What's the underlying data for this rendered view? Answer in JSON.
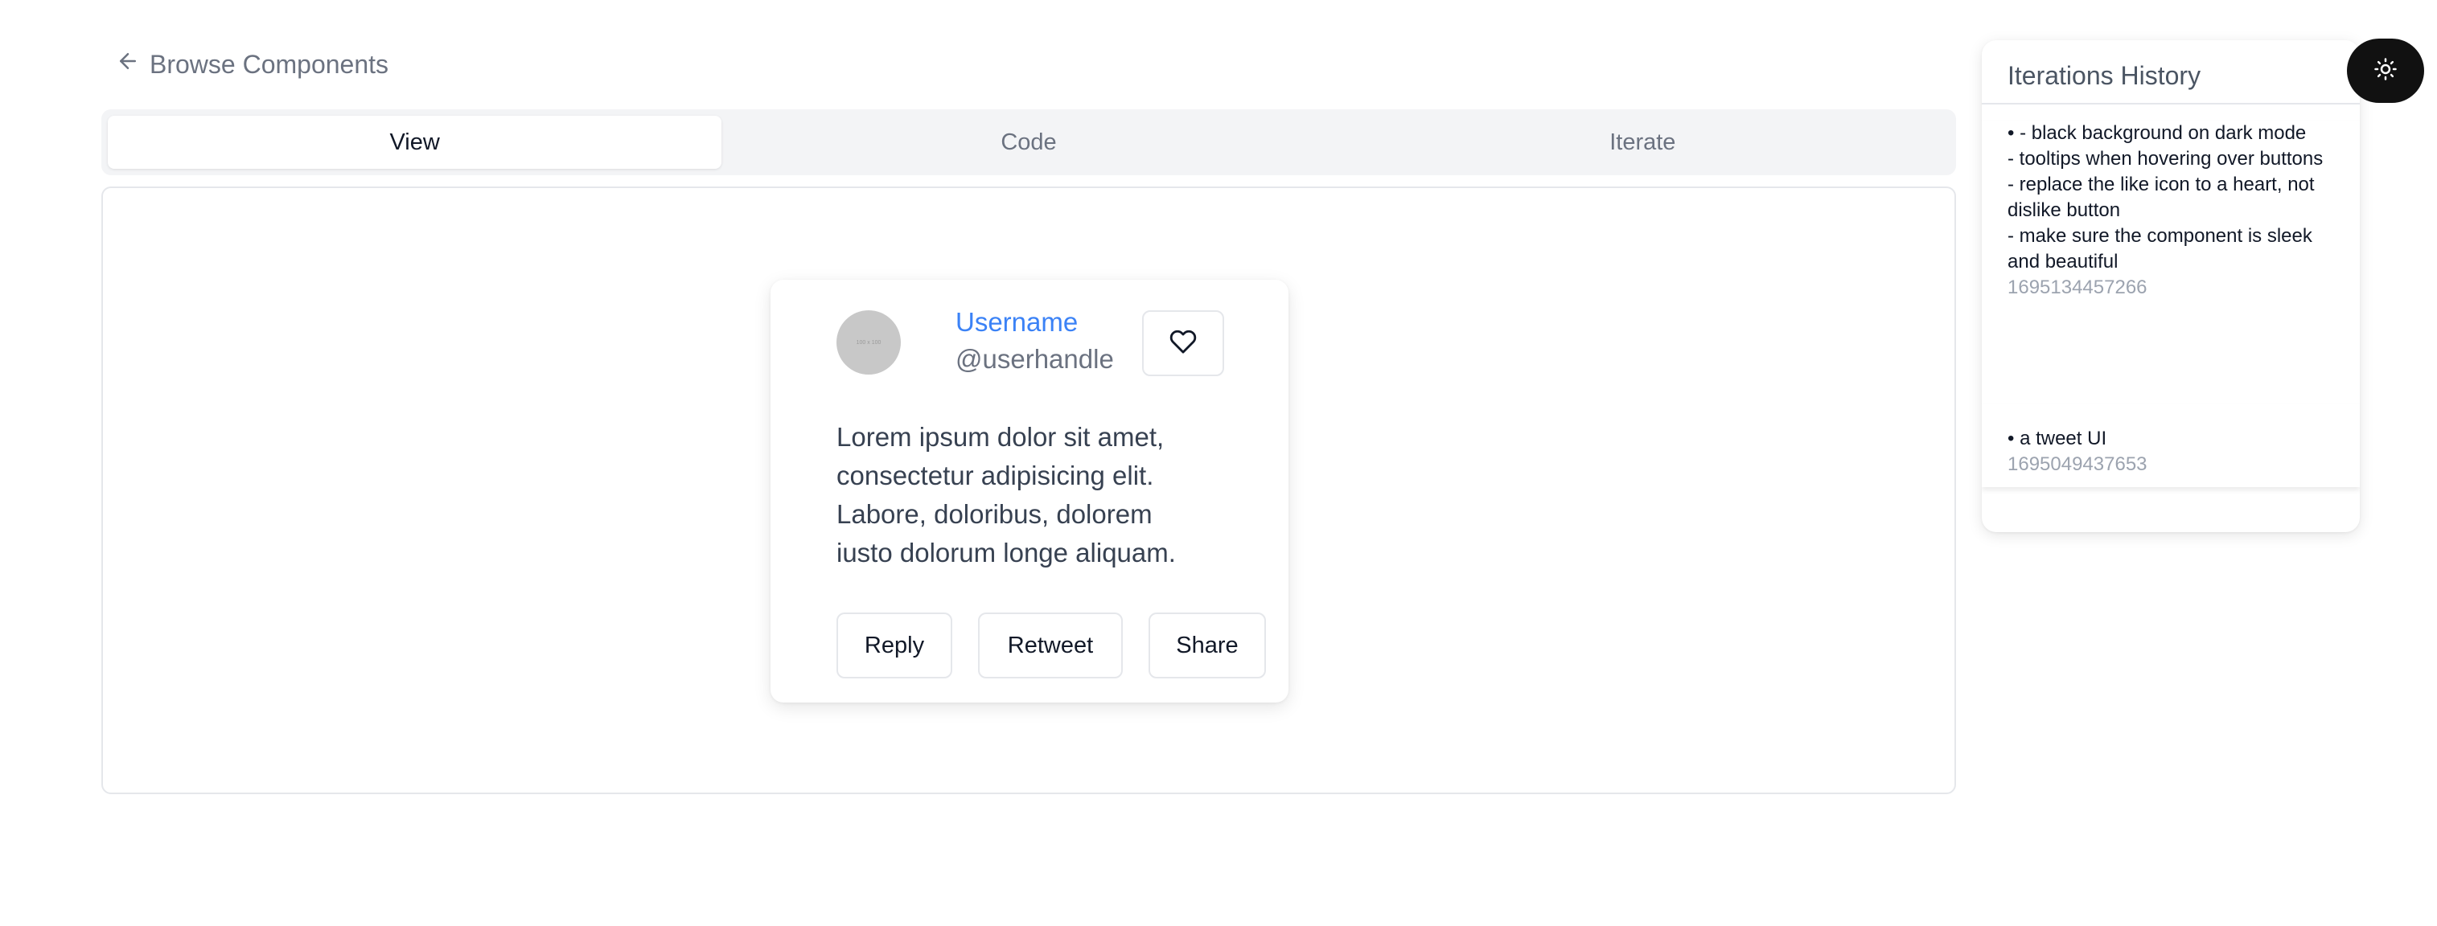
{
  "nav": {
    "back_label": "Browse Components"
  },
  "tabs": [
    {
      "label": "View",
      "active": true
    },
    {
      "label": "Code",
      "active": false
    },
    {
      "label": "Iterate",
      "active": false
    }
  ],
  "tweet": {
    "avatar_text": "100 x 100",
    "username": "Username",
    "handle": "@userhandle",
    "body": "Lorem ipsum dolor sit amet, consectetur adipisicing elit. Labore, doloribus, dolorem iusto dolorum longe aliquam.",
    "actions": {
      "reply": "Reply",
      "retweet": "Retweet",
      "share": "Share"
    },
    "like_icon": "heart-icon"
  },
  "history": {
    "title": "Iterations History",
    "items": [
      {
        "prompt": "• - black background on dark mode\n- tooltips when hovering over buttons\n- replace the like icon to a heart, not dislike button\n- make sure the component is sleek and beautiful",
        "timestamp": "1695134457266"
      },
      {
        "prompt": "• a tweet UI",
        "timestamp": "1695049437653"
      }
    ]
  },
  "theme_toggle": {
    "icon": "sun-icon"
  },
  "colors": {
    "accent_link": "#3b82f6",
    "toggle_bg": "#111111"
  }
}
